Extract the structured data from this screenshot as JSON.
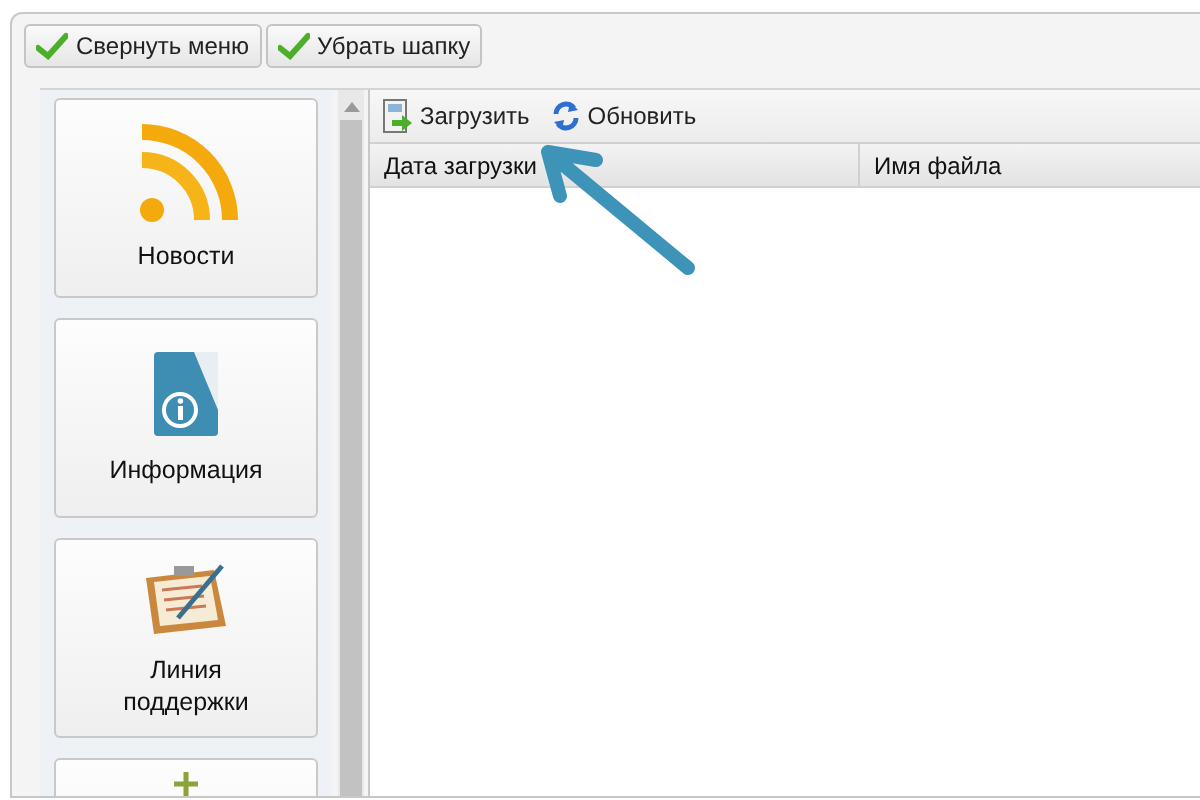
{
  "top_buttons": [
    {
      "label": "Свернуть меню"
    },
    {
      "label": "Убрать шапку"
    }
  ],
  "menu_tiles": [
    {
      "label": "Новости",
      "kind": "full"
    },
    {
      "label": "Информация",
      "kind": "full"
    },
    {
      "label": "Линия поддержки",
      "kind": "full"
    },
    {
      "kind": "cut_off"
    }
  ],
  "toolbar": [
    {
      "label": "Загрузить",
      "kind": "upload"
    },
    {
      "label": "Обновить",
      "kind": "refresh"
    }
  ],
  "table": {
    "columns": [
      "Дата загрузки",
      "Имя файла"
    ]
  },
  "annotation": {
    "kind": "arrow"
  }
}
